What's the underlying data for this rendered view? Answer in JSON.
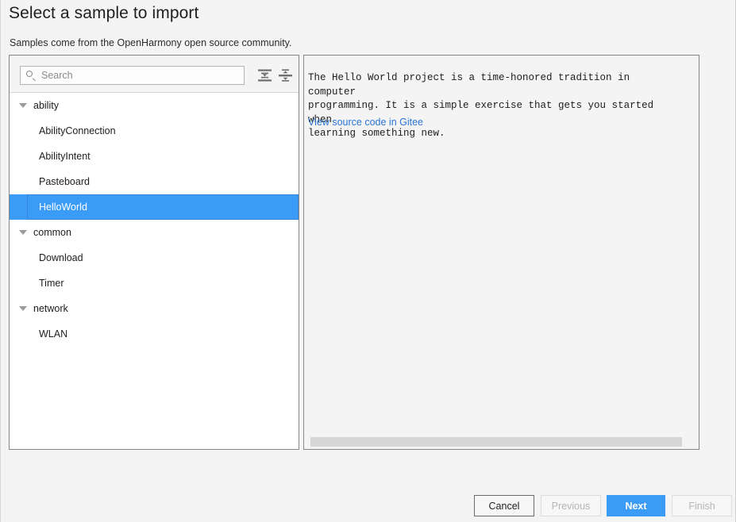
{
  "dialog": {
    "title": "Select a sample to import",
    "subtitle": "Samples come from the OpenHarmony open source community."
  },
  "search": {
    "placeholder": "Search",
    "value": ""
  },
  "toolbar": {
    "expand_all_tooltip": "Expand All",
    "collapse_all_tooltip": "Collapse All"
  },
  "tree": {
    "items": [
      {
        "label": "ability",
        "type": "group",
        "expanded": true,
        "selected": false
      },
      {
        "label": "AbilityConnection",
        "type": "child",
        "expanded": false,
        "selected": false
      },
      {
        "label": "AbilityIntent",
        "type": "child",
        "expanded": false,
        "selected": false
      },
      {
        "label": "Pasteboard",
        "type": "child",
        "expanded": false,
        "selected": false
      },
      {
        "label": "HelloWorld",
        "type": "child",
        "expanded": false,
        "selected": true
      },
      {
        "label": "common",
        "type": "group",
        "expanded": true,
        "selected": false
      },
      {
        "label": "Download",
        "type": "child",
        "expanded": false,
        "selected": false
      },
      {
        "label": "Timer",
        "type": "child",
        "expanded": false,
        "selected": false
      },
      {
        "label": "network",
        "type": "group",
        "expanded": true,
        "selected": false
      },
      {
        "label": "WLAN",
        "type": "child",
        "expanded": false,
        "selected": false
      }
    ]
  },
  "detail": {
    "description": "The Hello World project is a time-honored tradition in computer\nprogramming. It is a simple exercise that gets you started when\nlearning something new.",
    "link_text": "View source code in Gitee"
  },
  "footer": {
    "buttons": [
      {
        "label": "Cancel",
        "style": "default",
        "enabled": true
      },
      {
        "label": "Previous",
        "style": "disabled",
        "enabled": false
      },
      {
        "label": "Next",
        "style": "primary",
        "enabled": true
      },
      {
        "label": "Finish",
        "style": "disabled",
        "enabled": false
      }
    ]
  },
  "colors": {
    "accent": "#3b9cf7",
    "link": "#2a74d6",
    "panel_border": "#878787",
    "background": "#f4f4f4",
    "scrollbar_thumb": "#d6d6d6"
  }
}
